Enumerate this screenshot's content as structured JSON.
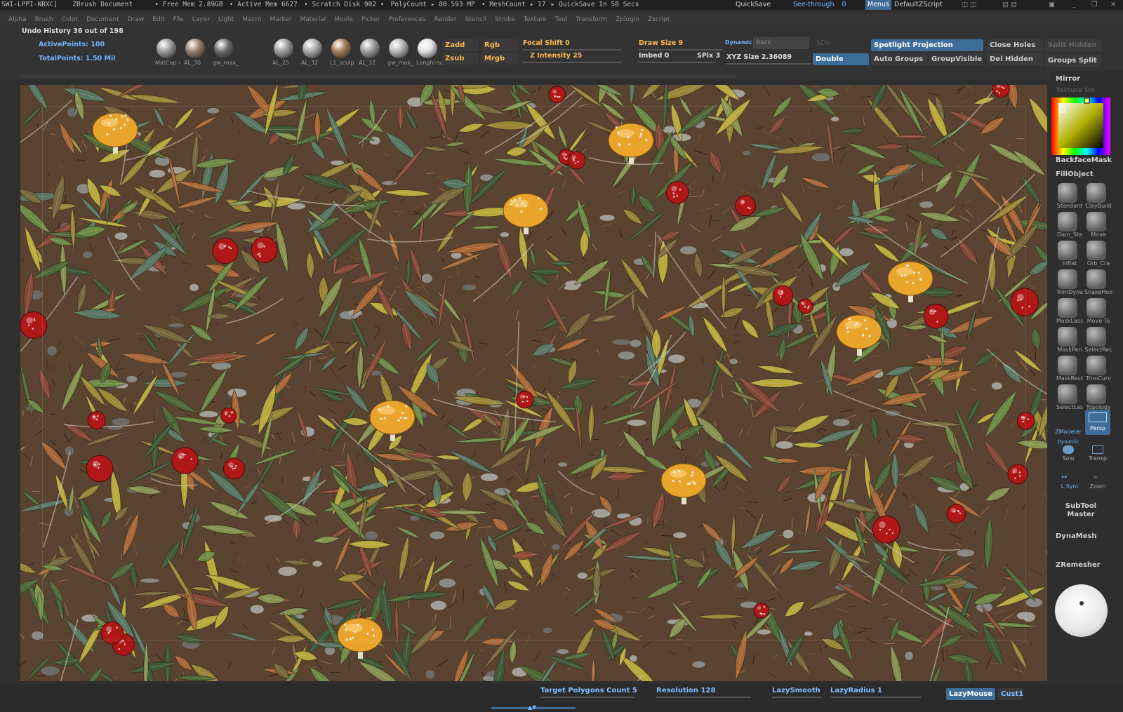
{
  "titlebar": {
    "doc": "SWI-LPPI-NRXC]",
    "app": "ZBrush Document",
    "free_mem": "• Free Mem 2.89GB",
    "active_mem": "• Active Mem 6627",
    "scratch": "• Scratch Disk 902 •",
    "polycount": "PolyCount ▸ 80.593 MP",
    "meshcount": "• MeshCount ▸ 17",
    "quicksave_in": "▸ QuickSave In 58 Secs",
    "quicksave_btn": "QuickSave",
    "seethrough_btn": "See-through",
    "seethrough_val": "0",
    "menus_btn": "Menus",
    "defaultzscript_btn": "DefaultZScript"
  },
  "menus": [
    "Alpha",
    "Brush",
    "Color",
    "Document",
    "Draw",
    "Edit",
    "File",
    "Layer",
    "Light",
    "Macro",
    "Marker",
    "Material",
    "Movie",
    "Picker",
    "Preferences",
    "Render",
    "Stencil",
    "Stroke",
    "Texture",
    "Tool",
    "Transform",
    "Zplugin",
    "Zscript"
  ],
  "shelf": {
    "undo": "Undo History 36 out of 198",
    "active_points": "ActivePoints: 100",
    "total_points": "TotalPoints: 1.50 Mil",
    "materials1": [
      {
        "label": "MatCap ‹",
        "color": "#9a9a9a"
      },
      {
        "label": "AL_30",
        "color": "#9a7d66"
      },
      {
        "label": "gw_max_",
        "color": "#6a6a6a"
      }
    ],
    "materials2": [
      {
        "label": "AL_25",
        "color": "#9a9a9a"
      },
      {
        "label": "AL_32",
        "color": "#a8a8a8"
      },
      {
        "label": "L1_sculp",
        "color": "#a07a55"
      },
      {
        "label": "AL_32",
        "color": "#9a9a9a"
      },
      {
        "label": "gw_max_",
        "color": "#b5b5b5"
      },
      {
        "label": "Longhi-sc",
        "color": "#e0e0e0"
      }
    ],
    "zadd": "Zadd",
    "zsub": "Zsub",
    "rgb": "Rgb",
    "mrgb": "Mrgb",
    "focal_shift": "Focal Shift 0",
    "z_intensity": "Z Intensity 25",
    "draw_size": "Draw Size 9",
    "dynamic": "Dynamic",
    "imbed": "Imbed 0",
    "spix": "SPix 3",
    "back": "Back",
    "sdiv": "SDiv",
    "xyz_size": "XYZ Size 2.36089",
    "double": "Double",
    "spotlight": "Spotlight Projection",
    "auto_groups": "Auto Groups",
    "group_visible": "GroupVisible",
    "close_holes": "Close Holes",
    "del_hidden": "Del Hidden",
    "split_hidden": "Split Hidden",
    "groups_split": "Groups Split"
  },
  "right_tray": {
    "mirror": "Mirror",
    "texture_on": "Texture On",
    "backfacemask": "BackfaceMask",
    "fillobject": "FillObject",
    "brushes": [
      "Standard",
      "ClayBuild",
      "Dam_Sta",
      "Move",
      "Inflat",
      "Orb_Cra",
      "TrimDyna",
      "SnakeHoo",
      "MaskLass",
      "Move To",
      "MaskPen",
      "SelectRec",
      "MaskRect",
      "TrimCurv",
      "SelectLas",
      "Topology"
    ],
    "zmodeler": "ZModeler",
    "persp": "Persp",
    "dynamic_solo": "Dynamic",
    "solo": "Solo",
    "transp": "Transp",
    "lsym": "L.Sym",
    "zoom": "Zoom",
    "subtool_master": "SubTool Master",
    "dynamesh": "DynaMesh",
    "zremesher": "ZRemesher"
  },
  "bottom": {
    "target_polygons": "Target Polygons Count 5",
    "resolution": "Resolution 128",
    "lazysmooth": "LazySmooth",
    "lazyradius": "LazyRadius 1",
    "lazymouse": "LazyMouse",
    "cust1": "Cust1"
  },
  "colors": {
    "accent": "#3f6d99",
    "label_blue": "#6fb7ff"
  }
}
